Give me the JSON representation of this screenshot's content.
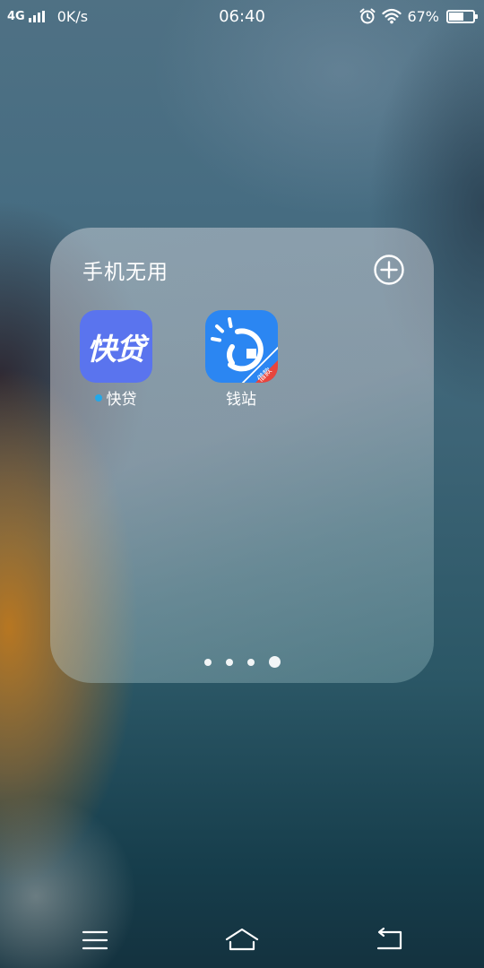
{
  "status_bar": {
    "network_type": "4G",
    "speed": "0K/s",
    "time": "06:40",
    "battery_percent_label": "67%",
    "battery_level": 0.67,
    "icons": [
      "signal-icon",
      "alarm-icon",
      "wifi-icon",
      "battery-icon"
    ]
  },
  "folder": {
    "title": "手机无用",
    "add_icon": "plus-circle-icon",
    "apps": [
      {
        "label": "快贷",
        "icon_text": "快贷",
        "icon_color": "#5a74ee",
        "has_new_dot": true
      },
      {
        "label": "钱站",
        "icon_badge": "借款",
        "icon_color": "#2b86f2",
        "badge_color": "#e8453c",
        "has_new_dot": false
      }
    ],
    "pages": {
      "count": 4,
      "current": 4
    }
  },
  "nav_bar": {
    "buttons": [
      "menu-icon",
      "home-icon",
      "back-icon"
    ]
  }
}
